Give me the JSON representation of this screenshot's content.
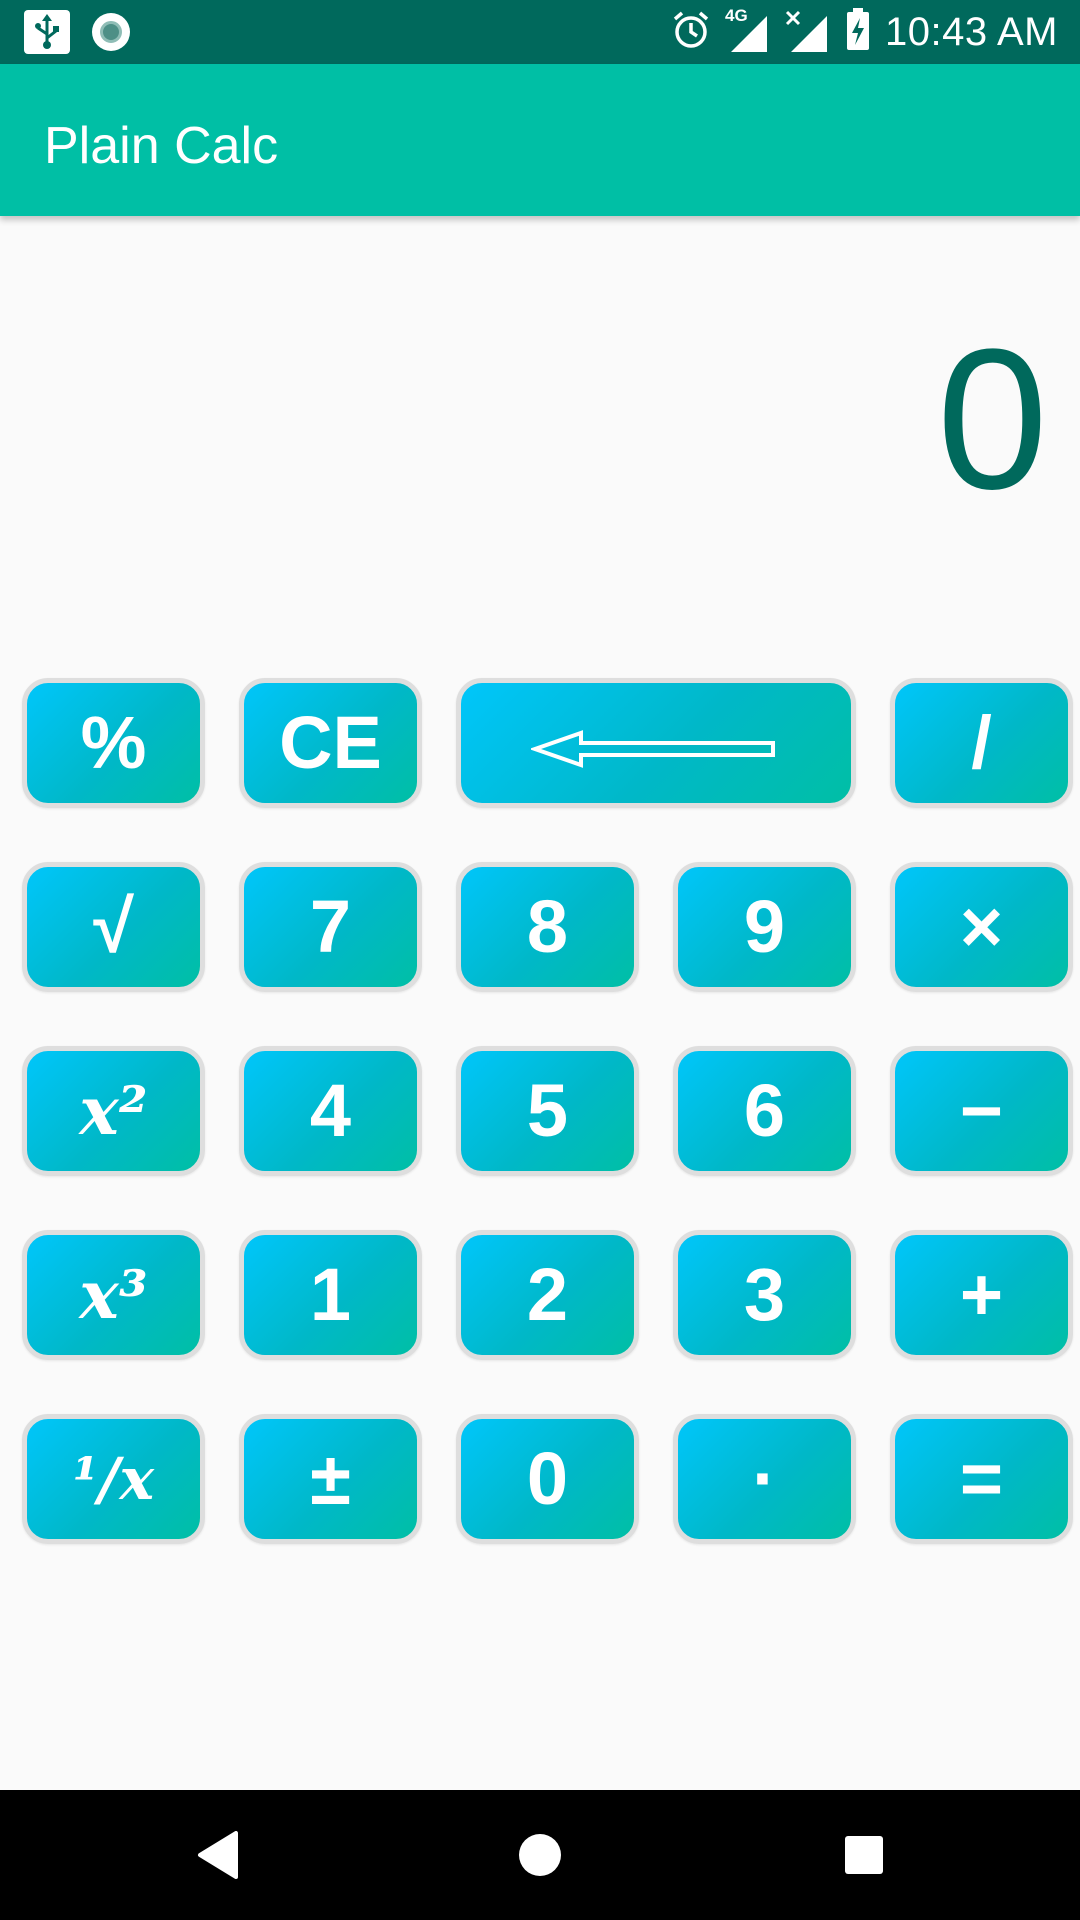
{
  "status_bar": {
    "time": "10:43 AM",
    "network_label": "4G",
    "icons": [
      "usb-icon",
      "record-icon",
      "alarm-icon",
      "signal-4g-icon",
      "signal-no-sim-icon",
      "battery-charging-icon"
    ]
  },
  "app_bar": {
    "title": "Plain Calc"
  },
  "display": {
    "value": "0"
  },
  "keypad": {
    "row1": {
      "percent": "%",
      "clear_entry": "CE",
      "divide": "/"
    },
    "row2": {
      "sqrt": "√",
      "seven": "7",
      "eight": "8",
      "nine": "9",
      "multiply": "×"
    },
    "row3": {
      "square": "x²",
      "four": "4",
      "five": "5",
      "six": "6",
      "subtract": "−"
    },
    "row4": {
      "cube": "x³",
      "one": "1",
      "two": "2",
      "three": "3",
      "add": "+"
    },
    "row5": {
      "reciprocal": "¹/x",
      "plus_minus": "±",
      "zero": "0",
      "decimal": "·",
      "equals": "="
    }
  },
  "nav_bar": {
    "icons": [
      "back-icon",
      "home-icon",
      "recents-icon"
    ]
  },
  "colors": {
    "status_bar": "#00695c",
    "app_bar": "#00bfa5",
    "display_text": "#00695c",
    "key_gradient_start": "#00c6fb",
    "key_gradient_end": "#00bfa5",
    "background": "#fafafa"
  }
}
